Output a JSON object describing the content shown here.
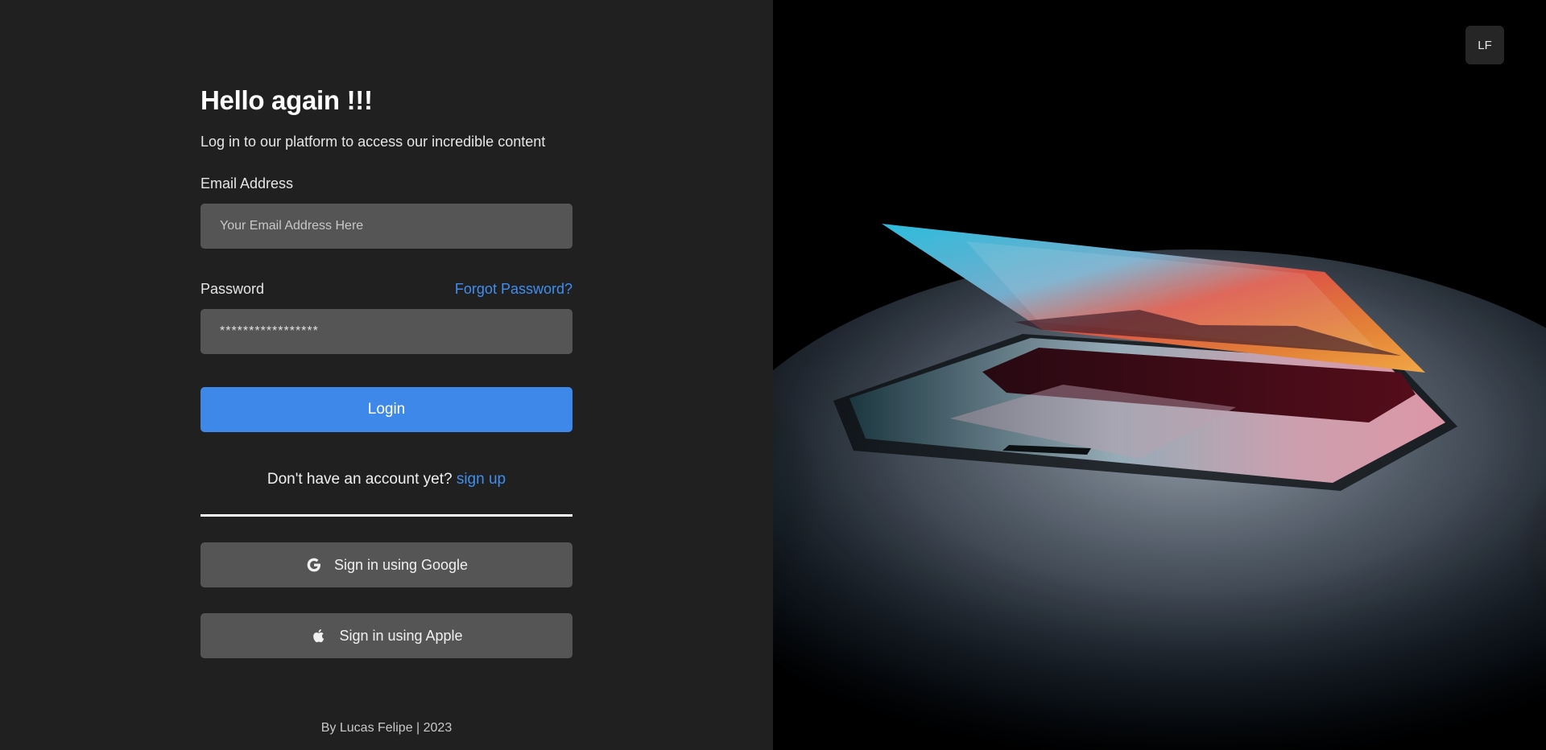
{
  "login": {
    "title": "Hello again !!!",
    "subtitle": "Log in to our platform to access our incredible content",
    "email_label": "Email Address",
    "email_placeholder": "Your Email Address Here",
    "password_label": "Password",
    "forgot_password": "Forgot Password?",
    "password_value": "*****************",
    "login_button": "Login",
    "no_account_text": "Don't have an account yet?",
    "signup_link": "sign up",
    "google_button": "Sign in using Google",
    "apple_button": "Sign in using Apple",
    "footer": "By Lucas Felipe | 2023"
  },
  "hero": {
    "avatar_initials": "LF",
    "image_subject": "laptop-photo"
  },
  "colors": {
    "background_left": "#202020",
    "input_bg": "#555555",
    "accent": "#3d88e8",
    "link": "#3f8ef0"
  }
}
